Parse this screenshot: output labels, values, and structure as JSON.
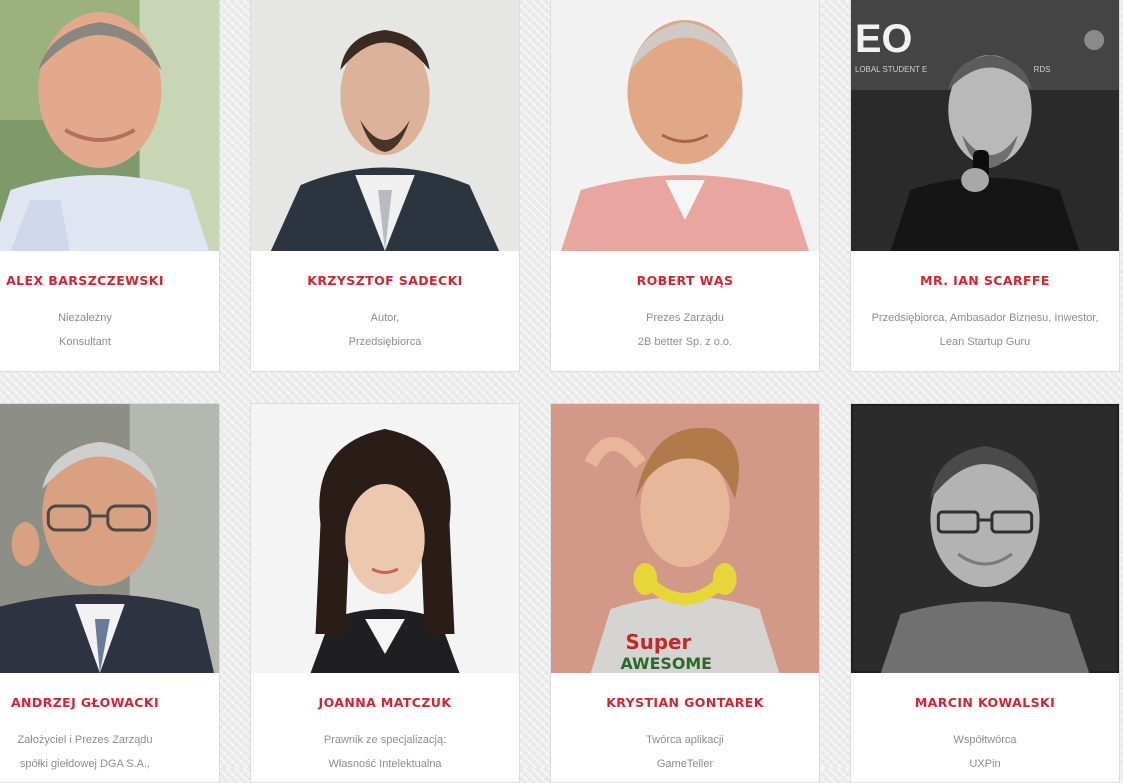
{
  "speakers": [
    {
      "name": "ALEX BARSZCZEWSKI",
      "role_line1": "Niezależny",
      "role_line2": "Konsultant"
    },
    {
      "name": "KRZYSZTOF SADECKI",
      "role_line1": "Autor,",
      "role_line2": "Przedsiębiorca"
    },
    {
      "name": "ROBERT WĄS",
      "role_line1": "Prezes Zarządu",
      "role_line2": "2B better Sp. z o.o."
    },
    {
      "name": "MR. IAN SCARFFE",
      "role_line1": "Przedsiębiorca, Ambasador Biznesu, Inwestor,",
      "role_line2": "Lean Startup Guru"
    },
    {
      "name": "ANDRZEJ GŁOWACKI",
      "role_line1": "Założyciel i Prezes Zarządu",
      "role_line2": "spółki giełdowej DGA S.A.,"
    },
    {
      "name": "JOANNA MATCZUK",
      "role_line1": "Prawnik ze specjalizacją:",
      "role_line2": "Własność Intelektualna"
    },
    {
      "name": "KRYSTIAN GONTAREK",
      "role_line1": "Twórca aplikacji",
      "role_line2": "GameTeller"
    },
    {
      "name": "MARCIN KOWALSKI",
      "role_line1": "Współtwórca",
      "role_line2": "UXPin"
    }
  ],
  "photo_text": {
    "banner_logo": "EO",
    "banner_line": "LOBAL STUDENT E",
    "banner_suffix": "RDS",
    "shirt_line1": "Super",
    "shirt_line2": "AWESOME"
  },
  "colors": {
    "name_red": "#d8232a",
    "role_gray": "#8c8c8c",
    "card_bg": "#ffffff",
    "page_bg": "#ececec"
  }
}
